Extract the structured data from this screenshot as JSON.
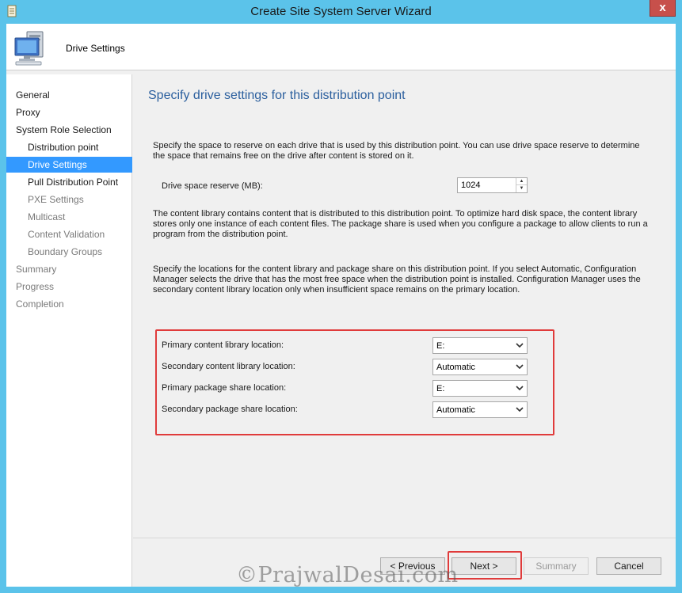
{
  "window": {
    "title": "Create Site System Server Wizard",
    "close_glyph": "x"
  },
  "header": {
    "title": "Drive Settings",
    "icon": "computer-icon"
  },
  "nav": {
    "items": [
      {
        "label": "General",
        "level": 0,
        "state": "normal"
      },
      {
        "label": "Proxy",
        "level": 0,
        "state": "normal"
      },
      {
        "label": "System Role Selection",
        "level": 0,
        "state": "normal"
      },
      {
        "label": "Distribution point",
        "level": 1,
        "state": "normal"
      },
      {
        "label": "Drive Settings",
        "level": 1,
        "state": "active"
      },
      {
        "label": "Pull Distribution Point",
        "level": 1,
        "state": "normal"
      },
      {
        "label": "PXE Settings",
        "level": 1,
        "state": "disabled"
      },
      {
        "label": "Multicast",
        "level": 1,
        "state": "disabled"
      },
      {
        "label": "Content Validation",
        "level": 1,
        "state": "disabled"
      },
      {
        "label": "Boundary Groups",
        "level": 1,
        "state": "disabled"
      },
      {
        "label": "Summary",
        "level": 0,
        "state": "disabled"
      },
      {
        "label": "Progress",
        "level": 0,
        "state": "disabled"
      },
      {
        "label": "Completion",
        "level": 0,
        "state": "disabled"
      }
    ],
    "active_color": "#3399ff"
  },
  "content": {
    "page_title": "Specify drive settings for this distribution point",
    "para1": "Specify the space to reserve on each drive that is used by this distribution point. You can use drive space reserve to determine the space that remains free on the drive after content is stored on it.",
    "reserve_label": "Drive space reserve (MB):",
    "reserve_value": "1024",
    "para2": "The content library contains content that is distributed to this distribution point. To optimize hard disk space, the content library stores only one instance of each content files. The package share is used when you configure a package to allow clients to run a program from the distribution point.",
    "para3": "Specify the locations for the content library and package share on this distribution point. If you select Automatic, Configuration Manager selects the drive that has the most free space when the distribution point is installed. Configuration Manager uses the secondary content library location only when insufficient space remains on the primary location.",
    "locations": [
      {
        "label": "Primary content library location:",
        "value": "E:"
      },
      {
        "label": "Secondary content library location:",
        "value": "Automatic"
      },
      {
        "label": "Primary package share location:",
        "value": "E:"
      },
      {
        "label": "Secondary package share location:",
        "value": "Automatic"
      }
    ],
    "highlight_color": "#e03b3b"
  },
  "footer": {
    "previous_label": "< Previous",
    "next_label": "Next >",
    "summary_label": "Summary",
    "cancel_label": "Cancel"
  },
  "watermark": "©PrajwalDesai.com"
}
